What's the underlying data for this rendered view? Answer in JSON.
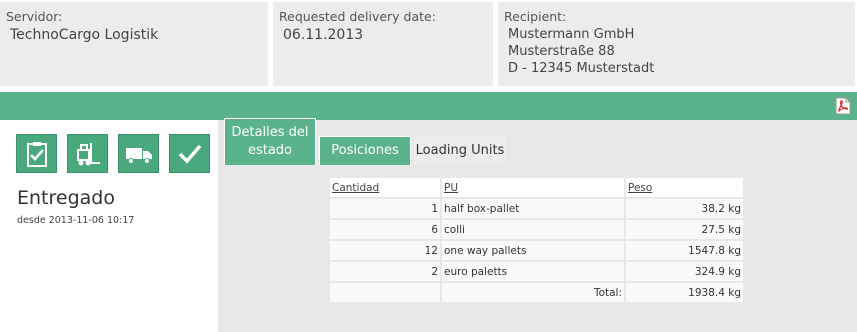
{
  "header": {
    "servidor": {
      "label": "Servidor:",
      "value": "TechnoCargo Logistik"
    },
    "delivery": {
      "label": "Requested delivery date:",
      "value": "06.11.2013"
    },
    "recipient": {
      "label": "Recipient:",
      "lines": [
        "Mustermann GmbH",
        "Musterstraße 88",
        "D - 12345 Musterstadt"
      ]
    }
  },
  "toolbar": {
    "pdf_icon": "pdf-icon"
  },
  "status": {
    "icons": [
      "clipboard-check-icon",
      "forklift-icon",
      "truck-icon",
      "checkmark-icon"
    ],
    "title": "Entregado",
    "since": "desde 2013-11-06 10:17"
  },
  "tabs": [
    {
      "label": "Detalles del estado",
      "active": false
    },
    {
      "label": "Posiciones",
      "active": false
    },
    {
      "label": "Loading Units",
      "active": true
    }
  ],
  "table": {
    "columns": [
      "Cantidad",
      "PU",
      "Peso"
    ],
    "rows": [
      {
        "qty": "1",
        "pu": "half box-pallet",
        "peso": "38.2 kg"
      },
      {
        "qty": "6",
        "pu": "colli",
        "peso": "27.5 kg"
      },
      {
        "qty": "12",
        "pu": "one way pallets",
        "peso": "1547.8 kg"
      },
      {
        "qty": "2",
        "pu": "euro paletts",
        "peso": "324.9 kg"
      }
    ],
    "total_label": "Total:",
    "total_value": "1938.4 kg"
  },
  "colors": {
    "accent": "#5bb38c",
    "icon_bg": "#4aa97c",
    "panel_bg": "#ececec"
  }
}
